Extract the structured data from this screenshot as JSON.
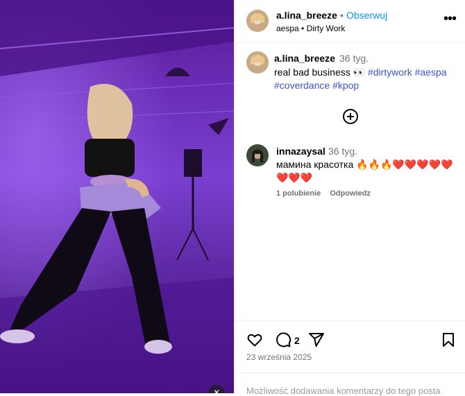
{
  "post": {
    "username": "a.lina_breeze",
    "separator": "•",
    "follow_label": "Obserwuj",
    "audio": "aespa • Dirty Work",
    "more_label": "•••"
  },
  "caption": {
    "username": "a.lina_breeze",
    "time": "36 tyg.",
    "text": "real bad business 👀",
    "hashtags": [
      "#dirtywork",
      "#aespa",
      "#coverdance",
      "#kpop"
    ]
  },
  "comments": [
    {
      "username": "innazaysal",
      "time": "36 tyg.",
      "text": "мамина красотка 🔥🔥🔥❤️❤️❤️❤️❤️❤️❤️❤️",
      "likes": "1 polubienie",
      "reply": "Odpowiedz"
    }
  ],
  "actions": {
    "comment_count": "2",
    "icons": [
      "heart-icon",
      "comment-icon",
      "share-icon",
      "bookmark-icon"
    ]
  },
  "date": "23 września 2025",
  "footer_text": "Możliwość dodawania komentarzy do tego posta",
  "colors": {
    "link": "#0095f6",
    "hashtag": "#3b55c9",
    "muted": "#737373",
    "media_bg": "#3a0f6e"
  }
}
